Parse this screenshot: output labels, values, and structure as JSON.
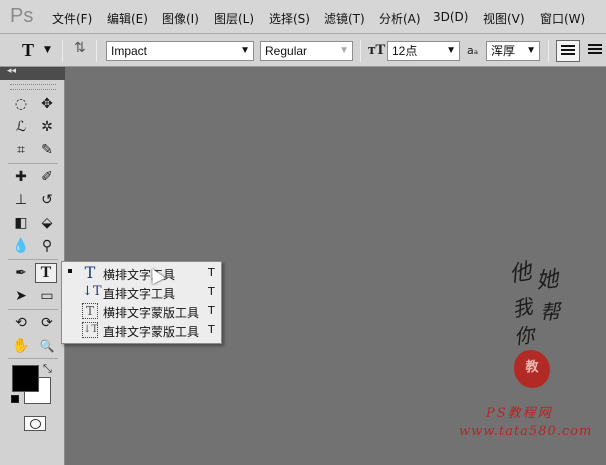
{
  "app": {
    "logo": "Ps"
  },
  "menubar": {
    "items": [
      "文件(F)",
      "编辑(E)",
      "图像(I)",
      "图层(L)",
      "选择(S)",
      "滤镜(T)",
      "分析(A)",
      "3D(D)",
      "视图(V)",
      "窗口(W)"
    ]
  },
  "options": {
    "tool_glyph": "T",
    "font_family": "Impact",
    "font_style": "Regular",
    "font_size": "12点",
    "antialias_label": "aₐ",
    "antialias": "浑厚"
  },
  "tools": [
    {
      "name": "marquee-tool-icon",
      "glyph": "◌"
    },
    {
      "name": "move-tool-icon",
      "glyph": "✥"
    },
    {
      "name": "lasso-tool-icon",
      "glyph": "ℒ"
    },
    {
      "name": "magic-wand-tool-icon",
      "glyph": "✲"
    },
    {
      "name": "crop-tool-icon",
      "glyph": "⌗"
    },
    {
      "name": "eyedropper-tool-icon",
      "glyph": "✎"
    },
    {
      "name": "healing-brush-tool-icon",
      "glyph": "✚"
    },
    {
      "name": "brush-tool-icon",
      "glyph": "✐"
    },
    {
      "name": "clone-stamp-tool-icon",
      "glyph": "⊥"
    },
    {
      "name": "history-brush-tool-icon",
      "glyph": "↺"
    },
    {
      "name": "eraser-tool-icon",
      "glyph": "◧"
    },
    {
      "name": "paint-bucket-tool-icon",
      "glyph": "⬙"
    },
    {
      "name": "blur-tool-icon",
      "glyph": "💧"
    },
    {
      "name": "dodge-tool-icon",
      "glyph": "⚲"
    },
    {
      "name": "pen-tool-icon",
      "glyph": "✒"
    },
    {
      "name": "type-tool-icon",
      "glyph": "T"
    },
    {
      "name": "path-selection-tool-icon",
      "glyph": "➤"
    },
    {
      "name": "rectangle-tool-icon",
      "glyph": "▭"
    },
    {
      "name": "3d-rotate-tool-icon",
      "glyph": "⟲"
    },
    {
      "name": "3d-orbit-tool-icon",
      "glyph": "⟳"
    },
    {
      "name": "hand-tool-icon",
      "glyph": "✋"
    },
    {
      "name": "zoom-tool-icon",
      "glyph": "🔍"
    }
  ],
  "flyout": {
    "items": [
      {
        "label": "横排文字工具",
        "key": "T",
        "icon": "T",
        "selected": true
      },
      {
        "label": "直排文字工具",
        "key": "T",
        "icon": "↓T",
        "selected": false
      },
      {
        "label": "横排文字蒙版工具",
        "key": "T",
        "icon": "T",
        "selected": false
      },
      {
        "label": "直排文字蒙版工具",
        "key": "T",
        "icon": "↓T",
        "selected": false
      }
    ]
  },
  "colors": {
    "foreground": "#000000",
    "background": "#ffffff"
  },
  "watermark": {
    "chars": [
      "他",
      "她",
      "我",
      "帮",
      "你"
    ],
    "seal": "教",
    "line1": "PS教程网",
    "line2": "www.tata580.com"
  }
}
